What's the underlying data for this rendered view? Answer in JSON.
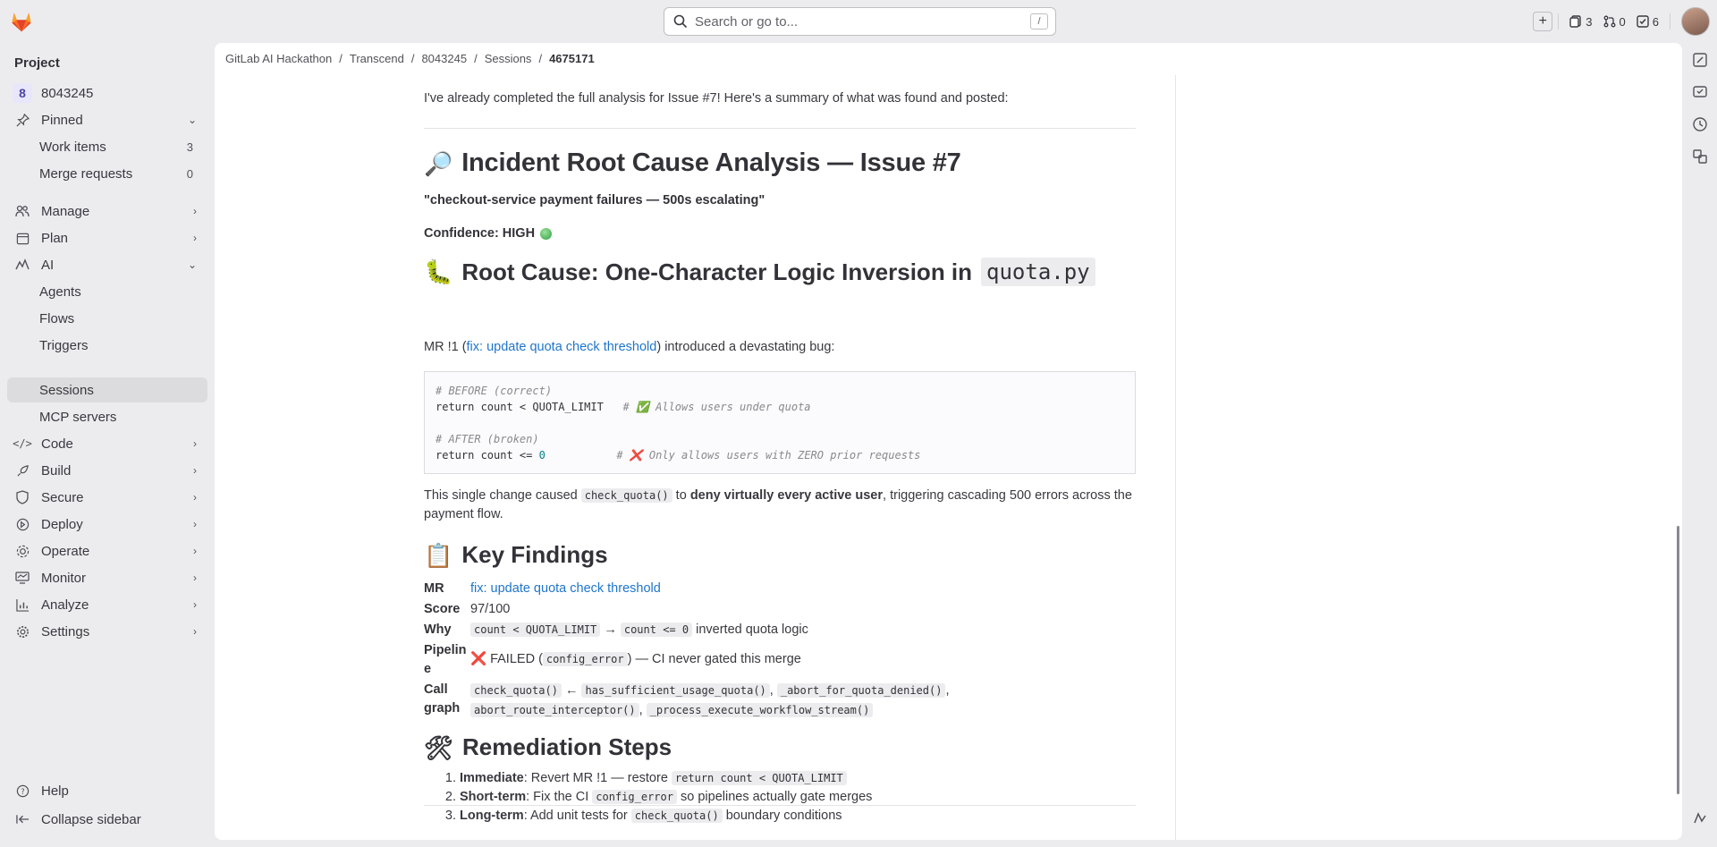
{
  "topbar": {
    "search_placeholder": "Search or go to...",
    "search_kbd": "/",
    "issues_count": "3",
    "mr_count": "0",
    "todo_count": "6"
  },
  "sidebar": {
    "title": "Project",
    "project_badge": "8",
    "project_name": "8043245",
    "pinned": "Pinned",
    "pinned_items": [
      {
        "label": "Work items",
        "count": "3"
      },
      {
        "label": "Merge requests",
        "count": "0"
      }
    ],
    "manage": "Manage",
    "plan": "Plan",
    "ai": "AI",
    "ai_items": [
      "Agents",
      "Flows",
      "Triggers",
      "Sessions",
      "MCP servers"
    ],
    "code": "Code",
    "build": "Build",
    "secure": "Secure",
    "deploy": "Deploy",
    "operate": "Operate",
    "monitor": "Monitor",
    "analyze": "Analyze",
    "settings": "Settings",
    "help": "Help",
    "collapse": "Collapse sidebar"
  },
  "breadcrumb": [
    "GitLab AI Hackathon",
    "Transcend",
    "8043245",
    "Sessions",
    "4675171"
  ],
  "doc": {
    "intro": "I've already completed the full analysis for Issue #7! Here's a summary of what was found and posted:",
    "h1": "Incident Root Cause Analysis — Issue #7",
    "quote": "\"checkout-service payment failures — 500s escalating\"",
    "confidence": "Confidence: HIGH",
    "h2_root_prefix": "Root Cause: One-Character Logic Inversion in",
    "h2_root_code": "quota.py",
    "mr_intro_pre": "MR !1 (",
    "mr_link": "fix: update quota check threshold",
    "mr_intro_post": ") introduced a devastating bug:",
    "code_lines": {
      "c1": "# BEFORE (correct)",
      "l1a": "return count < QUOTA_LIMIT   ",
      "l1c": "# ✅ Allows users under quota",
      "c2": "# AFTER (broken)",
      "l2a": "return count <= ",
      "l2n": "0",
      "l2s": "           ",
      "l2c": "# ❌ Only allows users with ZERO prior requests"
    },
    "change_pre": "This single change caused ",
    "change_code": "check_quota()",
    "change_mid": " to ",
    "change_bold": "deny virtually every active user",
    "change_post": ", triggering cascading 500 errors across the payment flow.",
    "h2_findings": "Key Findings",
    "findings": {
      "mr_k": "MR",
      "mr_v": "fix: update quota check threshold",
      "score_k": "Score",
      "score_v": "97/100",
      "why_k": "Why",
      "why_code1": "count < QUOTA_LIMIT",
      "why_arrow": "→",
      "why_code2": "count <= 0",
      "why_post": "inverted quota logic",
      "pipe_k": "Pipeline",
      "pipe_pre": "❌ FAILED (",
      "pipe_code": "config_error",
      "pipe_post": ") — CI never gated this merge",
      "call_k": "Call graph",
      "call_c1": "check_quota()",
      "call_arrow": "←",
      "call_c2": "has_sufficient_usage_quota()",
      "call_c3": "_abort_for_quota_denied()",
      "call_c4": "abort_route_interceptor()",
      "call_c5": "_process_execute_workflow_stream()"
    },
    "h2_remed": "Remediation Steps",
    "steps": [
      {
        "bold": "Immediate",
        "pre": ": Revert MR !1 — restore ",
        "code": "return count < QUOTA_LIMIT",
        "post": ""
      },
      {
        "bold": "Short-term",
        "pre": ": Fix the CI ",
        "code": "config_error",
        "post": " so pipelines actually gate merges"
      },
      {
        "bold": "Long-term",
        "pre": ": Add unit tests for ",
        "code": "check_quota()",
        "post": " boundary conditions"
      }
    ]
  }
}
